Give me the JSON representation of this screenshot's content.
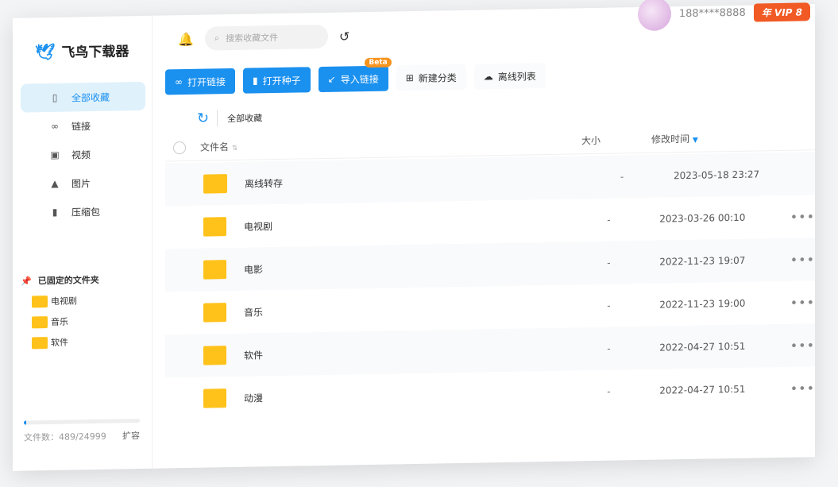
{
  "app": {
    "name": "飞鸟下载器"
  },
  "sidebar": {
    "items": [
      {
        "label": "全部收藏",
        "icon": "file-icon"
      },
      {
        "label": "链接",
        "icon": "link-icon"
      },
      {
        "label": "视频",
        "icon": "video-icon"
      },
      {
        "label": "图片",
        "icon": "image-icon"
      },
      {
        "label": "压缩包",
        "icon": "zip-icon"
      }
    ],
    "pinned_title": "已固定的文件夹",
    "pinned": [
      "电视剧",
      "音乐",
      "软件"
    ],
    "quota": {
      "label": "文件数：489/24999",
      "used": 489,
      "total": 24999,
      "expand": "扩容"
    }
  },
  "header": {
    "search_placeholder": "搜索收藏文件",
    "phone": "188****8888",
    "vip": "年 VIP 8"
  },
  "toolbar": {
    "open_link": "打开链接",
    "open_torrent": "打开种子",
    "import_link": "导入链接",
    "beta": "Beta",
    "new_category": "新建分类",
    "offline_list": "离线列表"
  },
  "breadcrumb": "全部收藏",
  "table": {
    "columns": {
      "name": "文件名",
      "size": "大小",
      "modified": "修改时间"
    },
    "rows": [
      {
        "name": "离线转存",
        "size": "-",
        "time": "2023-05-18 23:27"
      },
      {
        "name": "电视剧",
        "size": "-",
        "time": "2023-03-26 00:10"
      },
      {
        "name": "电影",
        "size": "-",
        "time": "2022-11-23 19:07"
      },
      {
        "name": "音乐",
        "size": "-",
        "time": "2022-11-23 19:00"
      },
      {
        "name": "软件",
        "size": "-",
        "time": "2022-04-27 10:51"
      },
      {
        "name": "动漫",
        "size": "-",
        "time": "2022-04-27 10:51"
      }
    ],
    "more": "•••"
  }
}
